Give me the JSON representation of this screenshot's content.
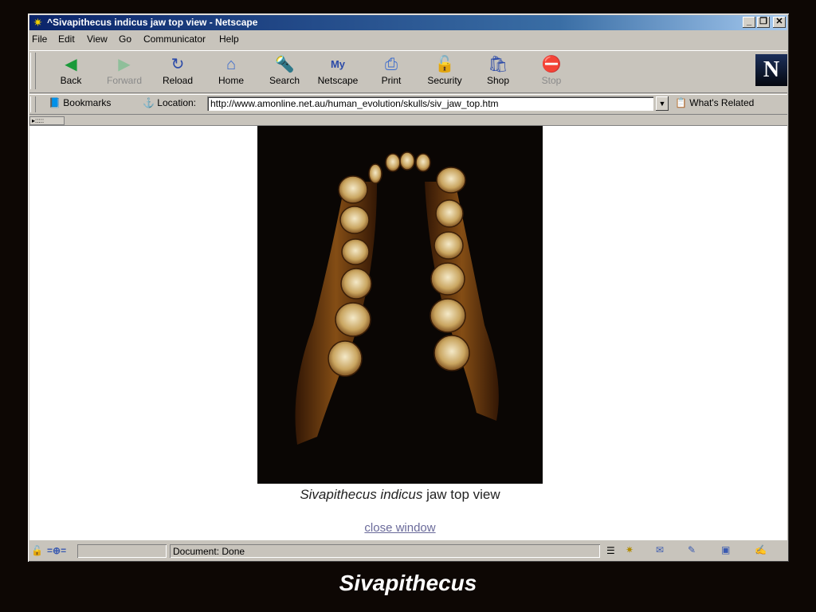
{
  "window": {
    "title": "^Sivapithecus indicus jaw top view - Netscape",
    "controls": [
      "_",
      "̲❐",
      "X"
    ]
  },
  "menu": [
    "File",
    "Edit",
    "View",
    "Go",
    "Communicator",
    "Help"
  ],
  "toolbar": {
    "buttons": [
      {
        "label": "Back",
        "icon": "back-arrow-icon",
        "enabled": true
      },
      {
        "label": "Forward",
        "icon": "forward-arrow-icon",
        "enabled": false
      },
      {
        "label": "Reload",
        "icon": "reload-icon",
        "enabled": true
      },
      {
        "label": "Home",
        "icon": "home-icon",
        "enabled": true
      },
      {
        "label": "Search",
        "icon": "search-icon",
        "enabled": true
      },
      {
        "label": "Netscape",
        "icon": "netscape-icon",
        "enabled": true
      },
      {
        "label": "Print",
        "icon": "print-icon",
        "enabled": true
      },
      {
        "label": "Security",
        "icon": "security-lock-icon",
        "enabled": true
      },
      {
        "label": "Shop",
        "icon": "shop-icon",
        "enabled": true
      },
      {
        "label": "Stop",
        "icon": "stop-icon",
        "enabled": false
      }
    ],
    "logo": "N"
  },
  "location": {
    "bookmarks_label": "Bookmarks",
    "location_label": "Location:",
    "url": "http://www.amonline.net.au/human_evolution/skulls/siv_jaw_top.htm",
    "related_label": "What's Related"
  },
  "page": {
    "caption_species": "Sivapithecus indicus",
    "caption_rest": " jaw top view",
    "close_link": "close window"
  },
  "status": {
    "text": "Document: Done"
  },
  "slide": {
    "title": "Sivapithecus"
  }
}
